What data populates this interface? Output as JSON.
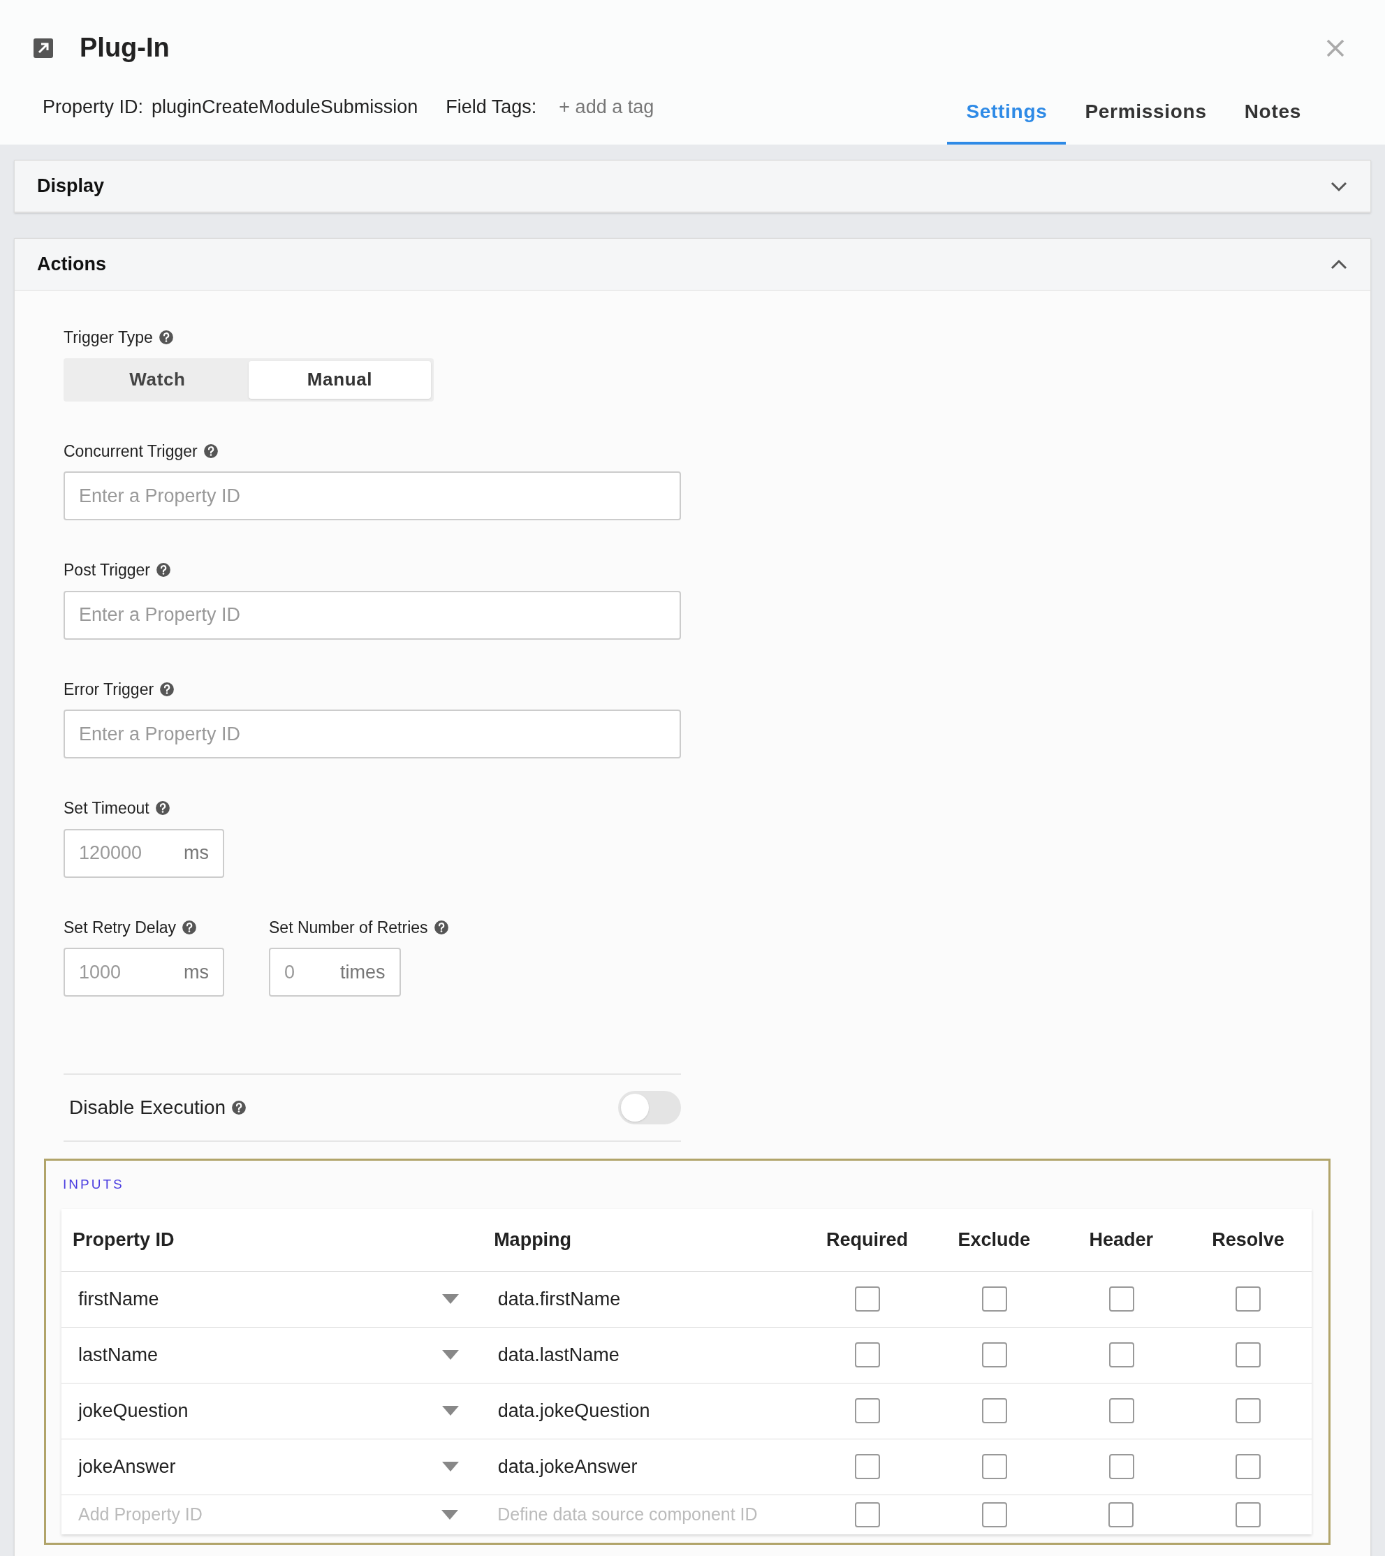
{
  "window": {
    "title": "Plug-In"
  },
  "header": {
    "property_id_label": "Property ID:",
    "property_id": "pluginCreateModuleSubmission",
    "field_tags_label": "Field Tags:",
    "add_tag": "+ add a tag"
  },
  "tabs": [
    {
      "label": "Settings",
      "selected": true
    },
    {
      "label": "Permissions",
      "selected": false
    },
    {
      "label": "Notes",
      "selected": false
    }
  ],
  "sections": [
    {
      "title": "Display",
      "expanded": false
    },
    {
      "title": "Actions",
      "expanded": true
    }
  ],
  "trigger_type": {
    "label": "Trigger Type",
    "options": [
      {
        "label": "Watch",
        "selected": false
      },
      {
        "label": "Manual",
        "selected": true
      }
    ]
  },
  "trigger_fields": [
    {
      "label": "Concurrent Trigger",
      "placeholder": "Enter a Property ID"
    },
    {
      "label": "Post Trigger",
      "placeholder": "Enter a Property ID"
    },
    {
      "label": "Error Trigger",
      "placeholder": "Enter a Property ID"
    }
  ],
  "timeout": {
    "label": "Set Timeout",
    "placeholder": "120000",
    "unit": "ms"
  },
  "retry_fields": [
    {
      "label": "Set Retry Delay",
      "placeholder": "1000",
      "unit": "ms"
    },
    {
      "label": "Set Number of Retries",
      "placeholder": "0",
      "unit": "times"
    }
  ],
  "disable_execution": {
    "label": "Disable Execution",
    "on": false
  },
  "inputs": {
    "title": "INPUTS",
    "columns": [
      "Property ID",
      "Mapping",
      "Required",
      "Exclude",
      "Header",
      "Resolve"
    ],
    "rows": [
      {
        "property_id": "firstName",
        "mapping": "data.firstName",
        "checks": [
          false,
          false,
          false,
          false
        ]
      },
      {
        "property_id": "lastName",
        "mapping": "data.lastName",
        "checks": [
          false,
          false,
          false,
          false
        ]
      },
      {
        "property_id": "jokeQuestion",
        "mapping": "data.jokeQuestion",
        "checks": [
          false,
          false,
          false,
          false
        ]
      },
      {
        "property_id": "jokeAnswer",
        "mapping": "data.jokeAnswer",
        "checks": [
          false,
          false,
          false,
          false
        ]
      }
    ],
    "new_row": {
      "property_placeholder": "Add Property ID",
      "mapping_placeholder": "Define data source component ID",
      "checks": [
        false,
        false,
        false,
        false
      ]
    }
  }
}
